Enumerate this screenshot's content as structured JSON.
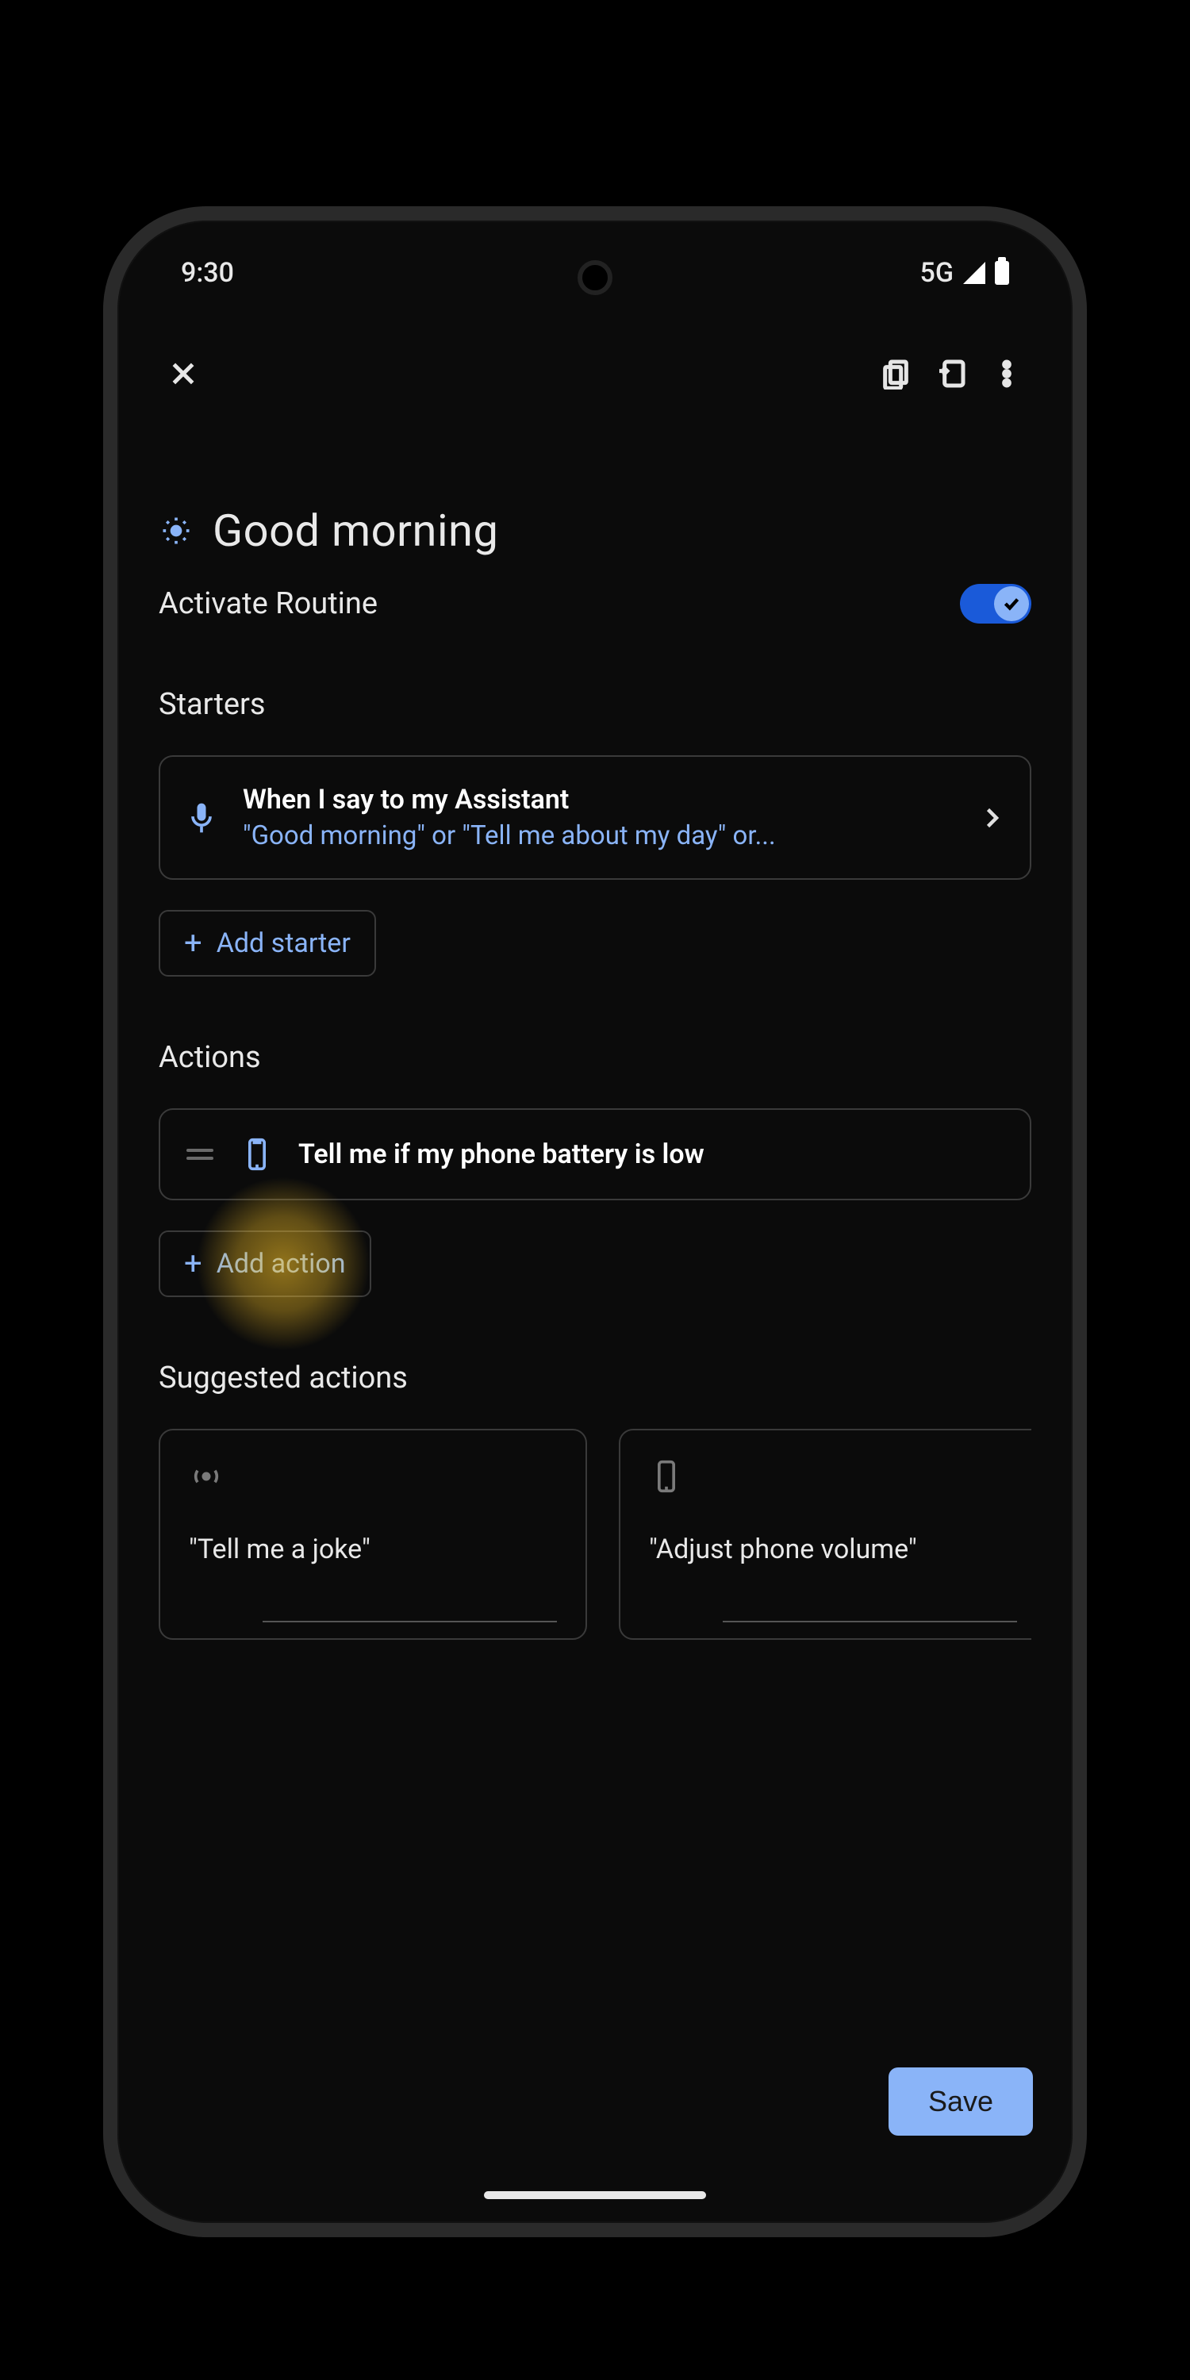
{
  "status": {
    "time": "9:30",
    "network": "5G"
  },
  "page": {
    "title": "Good morning",
    "activate_label": "Activate Routine",
    "activate_on": true
  },
  "starters": {
    "section_label": "Starters",
    "card": {
      "title": "When I say to my Assistant",
      "subtitle": "\"Good morning\" or \"Tell me about my day\" or..."
    },
    "add_label": "Add starter"
  },
  "actions": {
    "section_label": "Actions",
    "items": [
      {
        "text": "Tell me if my phone battery is low"
      }
    ],
    "add_label": "Add action"
  },
  "suggested": {
    "section_label": "Suggested actions",
    "items": [
      {
        "text": "\"Tell me a joke\""
      },
      {
        "text": "\"Adjust phone volume\""
      }
    ]
  },
  "save_label": "Save"
}
